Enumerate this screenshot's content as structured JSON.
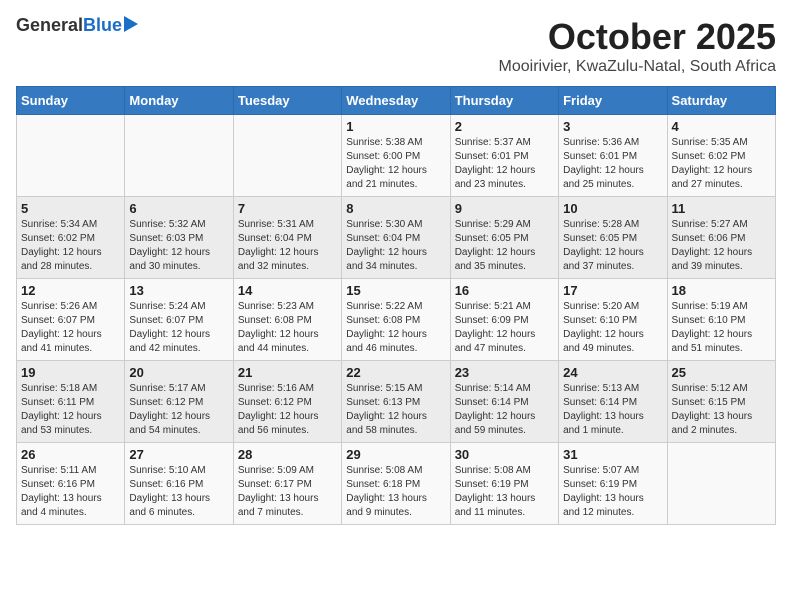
{
  "header": {
    "logo_general": "General",
    "logo_blue": "Blue",
    "title": "October 2025",
    "subtitle": "Mooirivier, KwaZulu-Natal, South Africa"
  },
  "days_of_week": [
    "Sunday",
    "Monday",
    "Tuesday",
    "Wednesday",
    "Thursday",
    "Friday",
    "Saturday"
  ],
  "weeks": [
    [
      {
        "day": "",
        "info": ""
      },
      {
        "day": "",
        "info": ""
      },
      {
        "day": "",
        "info": ""
      },
      {
        "day": "1",
        "info": "Sunrise: 5:38 AM\nSunset: 6:00 PM\nDaylight: 12 hours\nand 21 minutes."
      },
      {
        "day": "2",
        "info": "Sunrise: 5:37 AM\nSunset: 6:01 PM\nDaylight: 12 hours\nand 23 minutes."
      },
      {
        "day": "3",
        "info": "Sunrise: 5:36 AM\nSunset: 6:01 PM\nDaylight: 12 hours\nand 25 minutes."
      },
      {
        "day": "4",
        "info": "Sunrise: 5:35 AM\nSunset: 6:02 PM\nDaylight: 12 hours\nand 27 minutes."
      }
    ],
    [
      {
        "day": "5",
        "info": "Sunrise: 5:34 AM\nSunset: 6:02 PM\nDaylight: 12 hours\nand 28 minutes."
      },
      {
        "day": "6",
        "info": "Sunrise: 5:32 AM\nSunset: 6:03 PM\nDaylight: 12 hours\nand 30 minutes."
      },
      {
        "day": "7",
        "info": "Sunrise: 5:31 AM\nSunset: 6:04 PM\nDaylight: 12 hours\nand 32 minutes."
      },
      {
        "day": "8",
        "info": "Sunrise: 5:30 AM\nSunset: 6:04 PM\nDaylight: 12 hours\nand 34 minutes."
      },
      {
        "day": "9",
        "info": "Sunrise: 5:29 AM\nSunset: 6:05 PM\nDaylight: 12 hours\nand 35 minutes."
      },
      {
        "day": "10",
        "info": "Sunrise: 5:28 AM\nSunset: 6:05 PM\nDaylight: 12 hours\nand 37 minutes."
      },
      {
        "day": "11",
        "info": "Sunrise: 5:27 AM\nSunset: 6:06 PM\nDaylight: 12 hours\nand 39 minutes."
      }
    ],
    [
      {
        "day": "12",
        "info": "Sunrise: 5:26 AM\nSunset: 6:07 PM\nDaylight: 12 hours\nand 41 minutes."
      },
      {
        "day": "13",
        "info": "Sunrise: 5:24 AM\nSunset: 6:07 PM\nDaylight: 12 hours\nand 42 minutes."
      },
      {
        "day": "14",
        "info": "Sunrise: 5:23 AM\nSunset: 6:08 PM\nDaylight: 12 hours\nand 44 minutes."
      },
      {
        "day": "15",
        "info": "Sunrise: 5:22 AM\nSunset: 6:08 PM\nDaylight: 12 hours\nand 46 minutes."
      },
      {
        "day": "16",
        "info": "Sunrise: 5:21 AM\nSunset: 6:09 PM\nDaylight: 12 hours\nand 47 minutes."
      },
      {
        "day": "17",
        "info": "Sunrise: 5:20 AM\nSunset: 6:10 PM\nDaylight: 12 hours\nand 49 minutes."
      },
      {
        "day": "18",
        "info": "Sunrise: 5:19 AM\nSunset: 6:10 PM\nDaylight: 12 hours\nand 51 minutes."
      }
    ],
    [
      {
        "day": "19",
        "info": "Sunrise: 5:18 AM\nSunset: 6:11 PM\nDaylight: 12 hours\nand 53 minutes."
      },
      {
        "day": "20",
        "info": "Sunrise: 5:17 AM\nSunset: 6:12 PM\nDaylight: 12 hours\nand 54 minutes."
      },
      {
        "day": "21",
        "info": "Sunrise: 5:16 AM\nSunset: 6:12 PM\nDaylight: 12 hours\nand 56 minutes."
      },
      {
        "day": "22",
        "info": "Sunrise: 5:15 AM\nSunset: 6:13 PM\nDaylight: 12 hours\nand 58 minutes."
      },
      {
        "day": "23",
        "info": "Sunrise: 5:14 AM\nSunset: 6:14 PM\nDaylight: 12 hours\nand 59 minutes."
      },
      {
        "day": "24",
        "info": "Sunrise: 5:13 AM\nSunset: 6:14 PM\nDaylight: 13 hours\nand 1 minute."
      },
      {
        "day": "25",
        "info": "Sunrise: 5:12 AM\nSunset: 6:15 PM\nDaylight: 13 hours\nand 2 minutes."
      }
    ],
    [
      {
        "day": "26",
        "info": "Sunrise: 5:11 AM\nSunset: 6:16 PM\nDaylight: 13 hours\nand 4 minutes."
      },
      {
        "day": "27",
        "info": "Sunrise: 5:10 AM\nSunset: 6:16 PM\nDaylight: 13 hours\nand 6 minutes."
      },
      {
        "day": "28",
        "info": "Sunrise: 5:09 AM\nSunset: 6:17 PM\nDaylight: 13 hours\nand 7 minutes."
      },
      {
        "day": "29",
        "info": "Sunrise: 5:08 AM\nSunset: 6:18 PM\nDaylight: 13 hours\nand 9 minutes."
      },
      {
        "day": "30",
        "info": "Sunrise: 5:08 AM\nSunset: 6:19 PM\nDaylight: 13 hours\nand 11 minutes."
      },
      {
        "day": "31",
        "info": "Sunrise: 5:07 AM\nSunset: 6:19 PM\nDaylight: 13 hours\nand 12 minutes."
      },
      {
        "day": "",
        "info": ""
      }
    ]
  ]
}
